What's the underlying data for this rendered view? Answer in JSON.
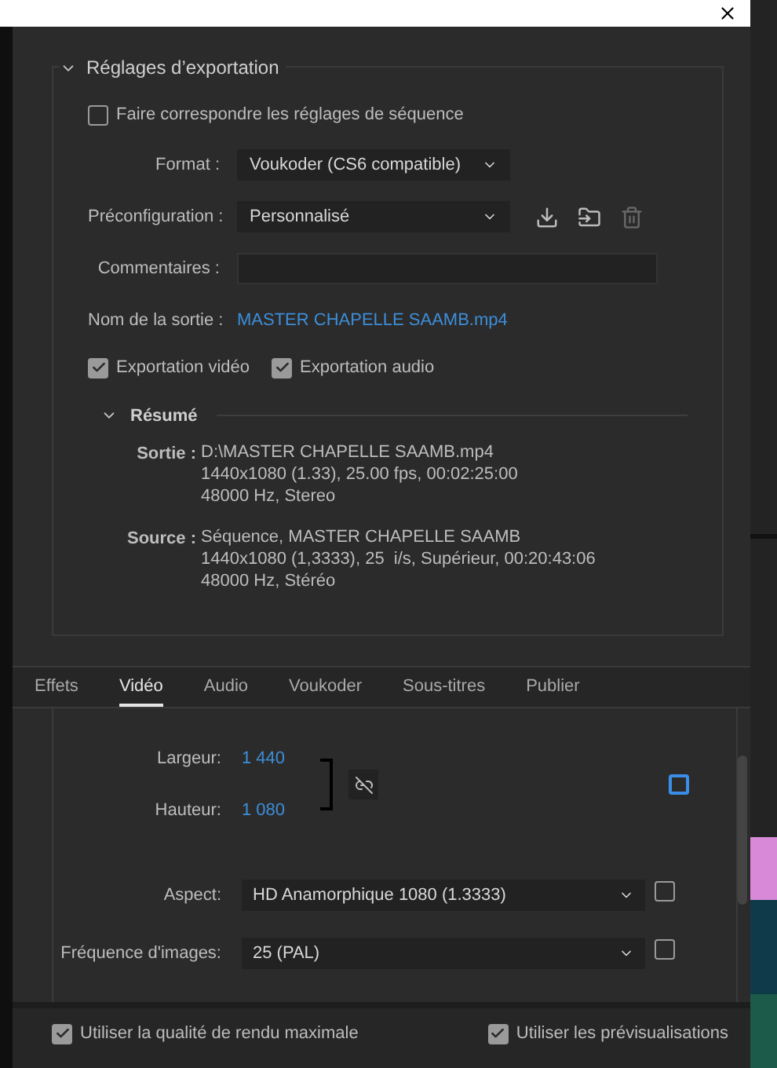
{
  "export_settings": {
    "title": "Réglages d’exportation",
    "expanded": true,
    "match_sequence": {
      "label": "Faire correspondre les réglages de séquence",
      "checked": false
    },
    "fields": [
      {
        "kind": "select",
        "label": "Format :",
        "value": "Voukoder (CS6 compatible)"
      },
      {
        "kind": "preset",
        "label": "Préconfiguration :",
        "value": "Personnalisé"
      },
      {
        "kind": "input",
        "label": "Commentaires :"
      },
      {
        "kind": "link",
        "label": "Nom de la sortie :",
        "value": "MASTER CHAPELLE SAAMB.mp4"
      }
    ],
    "exports": [
      {
        "label": "Exportation vidéo",
        "checked": true
      },
      {
        "label": "Exportation audio",
        "checked": true
      }
    ],
    "summary": {
      "title": "Résumé",
      "expanded": true,
      "entries": [
        {
          "label": "Sortie :",
          "lines": [
            "D:\\MASTER CHAPELLE SAAMB.mp4",
            "1440x1080 (1.33), 25.00 fps, 00:02:25:00",
            "48000 Hz, Stereo"
          ]
        },
        {
          "label": "Source :",
          "lines": [
            "Séquence, MASTER CHAPELLE SAAMB",
            "1440x1080 (1,3333), 25  i/s, Supérieur, 00:20:43:06",
            "48000 Hz, Stéréo"
          ]
        }
      ]
    }
  },
  "tabs": [
    {
      "label": "Effets",
      "selected": false
    },
    {
      "label": "Vidéo",
      "selected": true
    },
    {
      "label": "Audio",
      "selected": false
    },
    {
      "label": "Voukoder",
      "selected": false
    },
    {
      "label": "Sous-titres",
      "selected": false
    },
    {
      "label": "Publier",
      "selected": false
    }
  ],
  "video": {
    "width": {
      "label": "Largeur:",
      "value": "1 440"
    },
    "height": {
      "label": "Hauteur:",
      "value": "1 080"
    },
    "linked": false,
    "match_source_checked": false,
    "rows": [
      {
        "label": "Aspect:",
        "value": "HD Anamorphique 1080 (1.3333)",
        "checked": false
      },
      {
        "label": "Fréquence d'images:",
        "value": "25 (PAL)",
        "checked": false
      }
    ]
  },
  "options": [
    {
      "label": "Utiliser la qualité de rendu maximale",
      "checked": true
    },
    {
      "label": "Utiliser les prévisualisations",
      "checked": true
    }
  ]
}
